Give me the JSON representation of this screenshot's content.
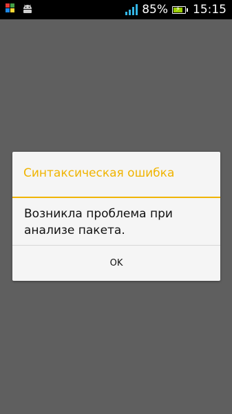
{
  "status_bar": {
    "battery_percent": "85%",
    "battery_level": 0.85,
    "time": "15:15",
    "icons": [
      "app-grid-icon",
      "android-debug-icon",
      "signal-icon",
      "battery-charging-icon"
    ]
  },
  "dialog": {
    "title": "Синтаксическая ошибка",
    "message": "Возникла проблема при анализе пакета.",
    "ok_label": "OK"
  },
  "colors": {
    "accent": "#f0b400",
    "signal": "#33b5e5",
    "battery": "#99cc00",
    "backdrop": "#5f5f5f"
  }
}
